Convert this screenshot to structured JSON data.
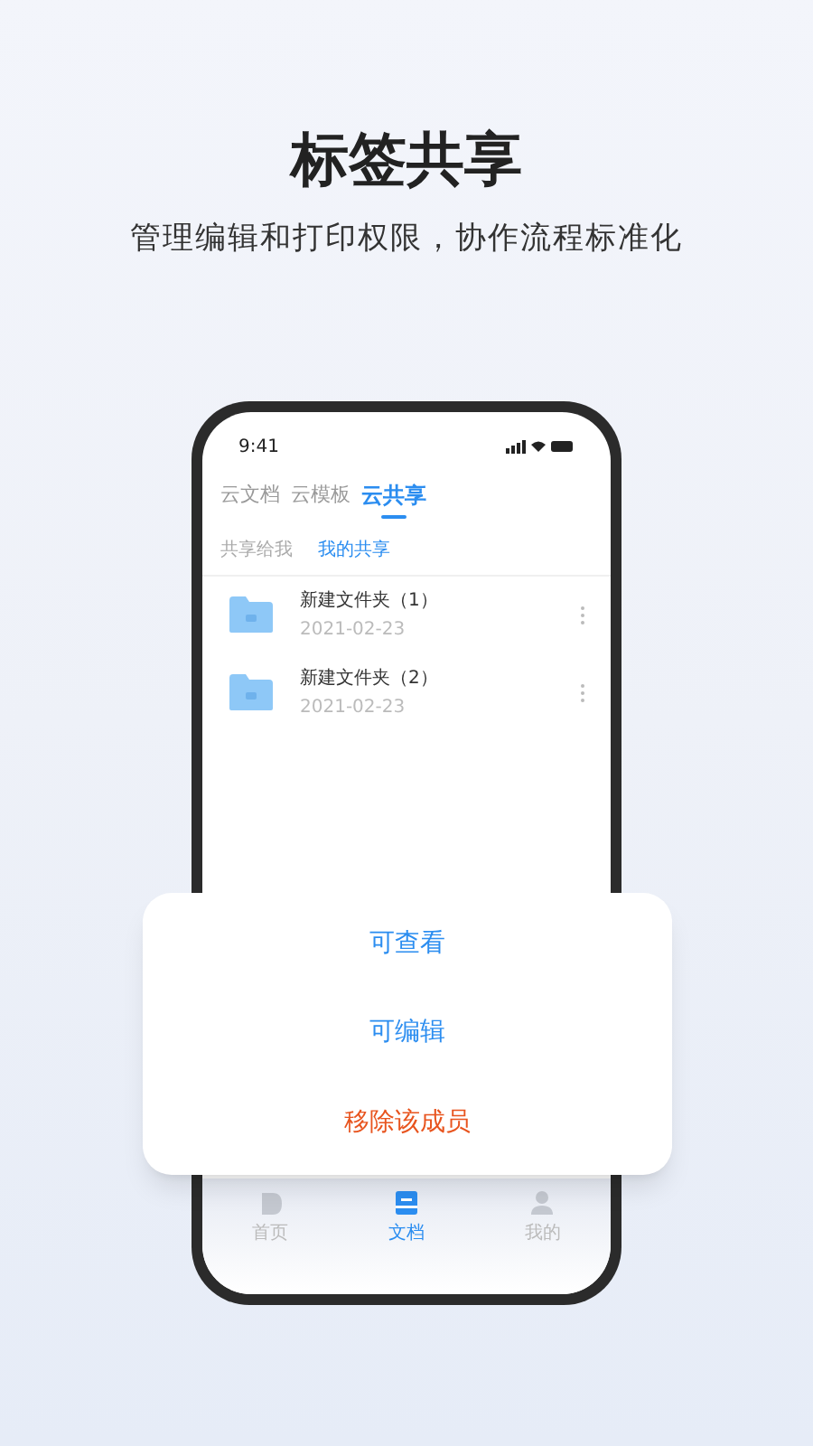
{
  "headline": "标签共享",
  "subtitle": "管理编辑和打印权限，协作流程标准化",
  "phone": {
    "status_time": "9:41",
    "tabs": [
      {
        "label": "云文档",
        "selected": false
      },
      {
        "label": "云模板",
        "selected": false
      },
      {
        "label": "云共享",
        "selected": true
      }
    ],
    "subtabs": [
      {
        "label": "共享给我",
        "selected": false
      },
      {
        "label": "我的共享",
        "selected": true
      }
    ],
    "files": [
      {
        "name": "新建文件夹（1）",
        "date": "2021-02-23"
      },
      {
        "name": "新建文件夹（2）",
        "date": "2021-02-23"
      }
    ],
    "nav": [
      {
        "label": "首页",
        "kind": "home",
        "selected": false
      },
      {
        "label": "文档",
        "kind": "docs",
        "selected": true
      },
      {
        "label": "我的",
        "kind": "me",
        "selected": false
      }
    ]
  },
  "sheet": {
    "actions": [
      {
        "label": "可查看",
        "kind": "normal"
      },
      {
        "label": "可编辑",
        "kind": "normal"
      },
      {
        "label": "移除该成员",
        "kind": "danger"
      }
    ]
  }
}
